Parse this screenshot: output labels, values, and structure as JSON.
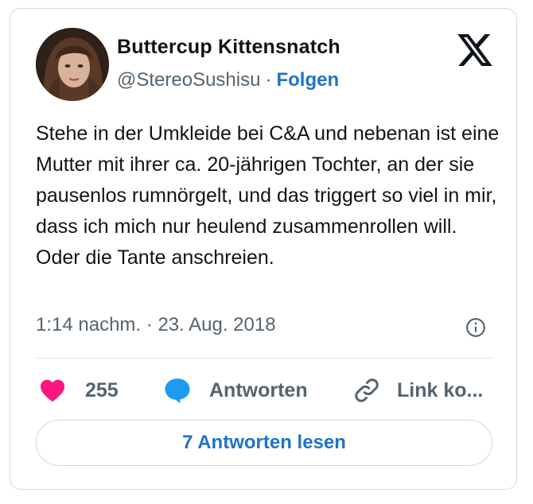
{
  "author": {
    "name": "Buttercup Kittensnatch",
    "handle": "@StereoSushisu",
    "separator": "·",
    "follow_label": "Folgen"
  },
  "tweet": {
    "text": "Stehe in der Umkleide bei C&A und nebenan ist eine Mutter mit ihrer ca. 20-jährigen Tochter, an der sie pausenlos rumnörgelt, und das triggert so viel in mir, dass ich mich nur heulend zusammenrollen will. Oder die Tante anschreien.",
    "time": "1:14 nachm.",
    "separator": "·",
    "date": "23. Aug. 2018"
  },
  "actions": {
    "like_count": "255",
    "reply_label": "Antworten",
    "copy_link_label": "Link ko..."
  },
  "read_replies_label": "7 Antworten lesen",
  "icons": {
    "brand": "x-logo-icon",
    "like": "heart-icon",
    "reply": "speech-bubble-icon",
    "copy": "link-icon",
    "info": "info-icon"
  },
  "colors": {
    "like": "#f91880",
    "reply": "#1d9bf0",
    "link_blue": "#1d73c9",
    "muted": "#536471",
    "border": "#cfd9de"
  }
}
